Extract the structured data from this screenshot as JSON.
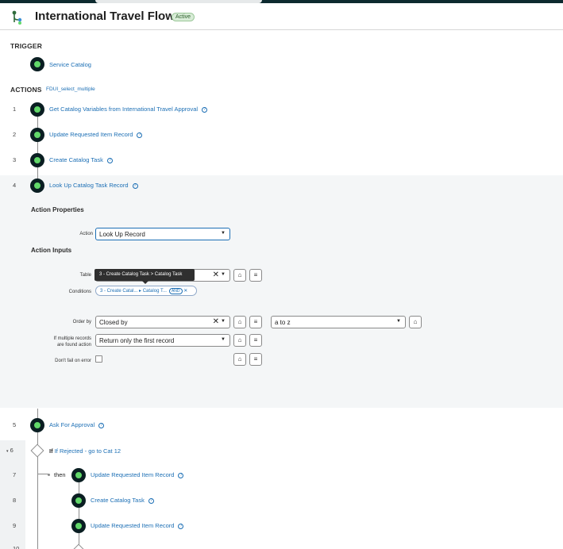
{
  "flow": {
    "title": "International Travel Flow",
    "status": "Active"
  },
  "trigger": {
    "heading": "TRIGGER",
    "link": "Service Catalog"
  },
  "actions": {
    "heading": "ACTIONS",
    "subtitle": "FDUI_select_multiple",
    "steps": [
      {
        "num": "1",
        "label": "Get Catalog Variables from International Travel Approval"
      },
      {
        "num": "2",
        "label": "Update Requested Item Record"
      },
      {
        "num": "3",
        "label": "Create Catalog Task"
      },
      {
        "num": "4",
        "label": "Look Up Catalog Task Record"
      }
    ]
  },
  "expanded": {
    "properties_heading": "Action Properties",
    "action_label": "Action",
    "action_value": "Look Up Record",
    "inputs_heading": "Action Inputs",
    "table_label": "Table",
    "tooltip": "3 - Create Catalog Task > Catalog Task",
    "conditions_label": "Conditions",
    "condition_pill": {
      "part1": "3 - Create Catal...",
      "part2": "Catalog T...",
      "badge": "AND"
    },
    "order_by_label": "Order by",
    "order_by_value": "Closed by",
    "order_dir_value": "a to z",
    "multiple_label_1": "If multiple records",
    "multiple_label_2": "are found action",
    "multiple_value": "Return only the first record",
    "dont_fail_label": "Don't fail on error"
  },
  "lower_steps": {
    "step5": {
      "num": "5",
      "label": "Ask For Approval"
    },
    "step6": {
      "num": "6",
      "keyword": "If",
      "label": "If Rejected - go to Cat 12"
    },
    "then_label": "then",
    "step7": {
      "num": "7",
      "label": "Update Requested Item Record"
    },
    "step8": {
      "num": "8",
      "label": "Create Catalog Task"
    },
    "step9": {
      "num": "9",
      "label": "Update Requested Item Record"
    },
    "step10": {
      "num": "10"
    }
  },
  "colors": {
    "link": "#1c6fb5",
    "node_fill": "#62d86a",
    "node_ring": "#0a1e22",
    "expanded_bg": "#f4f6f7"
  }
}
